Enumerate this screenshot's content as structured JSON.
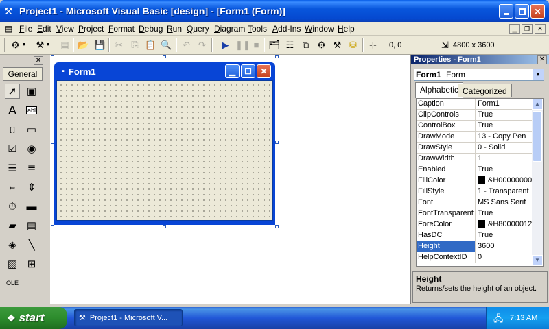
{
  "window": {
    "title": "Project1 - Microsoft Visual Basic [design] - [Form1 (Form)]"
  },
  "menu": [
    "File",
    "Edit",
    "View",
    "Project",
    "Format",
    "Debug",
    "Run",
    "Query",
    "Diagram",
    "Tools",
    "Add-Ins",
    "Window",
    "Help"
  ],
  "toolbar": {
    "position": "0, 0",
    "size": "4800 x 3600"
  },
  "toolbox": {
    "tab_label": "General",
    "tools": [
      {
        "name": "pointer-tool",
        "glyph": "➚",
        "selected": true
      },
      {
        "name": "picturebox-tool",
        "glyph": "▣"
      },
      {
        "name": "label-tool",
        "glyph": "A"
      },
      {
        "name": "textbox-tool",
        "glyph": "abl"
      },
      {
        "name": "frame-tool",
        "glyph": "[ ]"
      },
      {
        "name": "commandbutton-tool",
        "glyph": "▭"
      },
      {
        "name": "checkbox-tool",
        "glyph": "☑"
      },
      {
        "name": "optionbutton-tool",
        "glyph": "◉"
      },
      {
        "name": "combobox-tool",
        "glyph": "☰"
      },
      {
        "name": "listbox-tool",
        "glyph": "≣"
      },
      {
        "name": "hscrollbar-tool",
        "glyph": "⇔"
      },
      {
        "name": "vscrollbar-tool",
        "glyph": "⇕"
      },
      {
        "name": "timer-tool",
        "glyph": "⏱"
      },
      {
        "name": "drivelistbox-tool",
        "glyph": "▬"
      },
      {
        "name": "dirlistbox-tool",
        "glyph": "▰"
      },
      {
        "name": "filelistbox-tool",
        "glyph": "▤"
      },
      {
        "name": "shape-tool",
        "glyph": "◈"
      },
      {
        "name": "line-tool",
        "glyph": "╲"
      },
      {
        "name": "image-tool",
        "glyph": "▨"
      },
      {
        "name": "data-tool",
        "glyph": "⊞"
      },
      {
        "name": "ole-tool",
        "glyph": "OLE"
      }
    ]
  },
  "form": {
    "title": "Form1"
  },
  "properties": {
    "title": "Properties - Form1",
    "object_name": "Form1",
    "object_type": "Form",
    "tabs": [
      "Alphabetic",
      "Categorized"
    ],
    "rows": [
      {
        "name": "Caption",
        "value": "Form1"
      },
      {
        "name": "ClipControls",
        "value": "True"
      },
      {
        "name": "ControlBox",
        "value": "True"
      },
      {
        "name": "DrawMode",
        "value": "13 - Copy Pen"
      },
      {
        "name": "DrawStyle",
        "value": "0 - Solid"
      },
      {
        "name": "DrawWidth",
        "value": "1"
      },
      {
        "name": "Enabled",
        "value": "True"
      },
      {
        "name": "FillColor",
        "value": "&H00000000&",
        "swatch": "#000000"
      },
      {
        "name": "FillStyle",
        "value": "1 - Transparent"
      },
      {
        "name": "Font",
        "value": "MS Sans Serif"
      },
      {
        "name": "FontTransparent",
        "value": "True"
      },
      {
        "name": "ForeColor",
        "value": "&H80000012&",
        "swatch": "#000000"
      },
      {
        "name": "HasDC",
        "value": "True"
      },
      {
        "name": "Height",
        "value": "3600",
        "selected": true
      },
      {
        "name": "HelpContextID",
        "value": "0"
      }
    ],
    "description_title": "Height",
    "description_text": "Returns/sets the height of an object."
  },
  "taskbar": {
    "start_label": "start",
    "task_label": "Project1 - Microsoft V...",
    "clock": "7:13 AM"
  },
  "colors": {
    "xp_title_blue": "#0a5fe8",
    "start_green": "#2d8c2d",
    "selection_blue": "#316ac5"
  }
}
